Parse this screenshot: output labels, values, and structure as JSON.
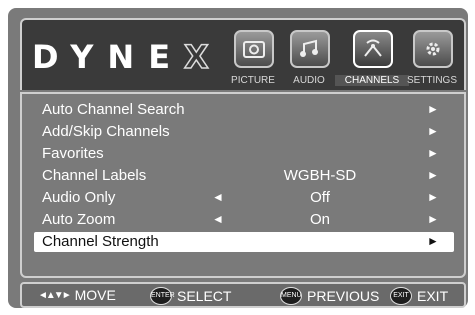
{
  "brand": {
    "logo_main": "DYNE",
    "logo_x": "X"
  },
  "tabs": [
    {
      "label": "PICTURE",
      "icon": "picture-icon",
      "active": false
    },
    {
      "label": "AUDIO",
      "icon": "audio-icon",
      "active": false
    },
    {
      "label": "CHANNELS",
      "icon": "channels-icon",
      "active": true
    },
    {
      "label": "SETTINGS",
      "icon": "settings-icon",
      "active": false
    }
  ],
  "menu": {
    "items": [
      {
        "label": "Auto Channel Search",
        "value": "",
        "has_left_arrow": false
      },
      {
        "label": "Add/Skip Channels",
        "value": "",
        "has_left_arrow": false
      },
      {
        "label": "Favorites",
        "value": "",
        "has_left_arrow": false
      },
      {
        "label": "Channel Labels",
        "value": "WGBH-SD",
        "has_left_arrow": false
      },
      {
        "label": "Audio Only",
        "value": "Off",
        "has_left_arrow": true
      },
      {
        "label": "Auto Zoom",
        "value": "On",
        "has_left_arrow": true
      },
      {
        "label": "Channel Strength",
        "value": "",
        "has_left_arrow": false,
        "selected": true
      }
    ]
  },
  "footer": {
    "move": "MOVE",
    "enter_badge": "ENTER",
    "select": "SELECT",
    "menu_badge": "MENU",
    "previous": "PREVIOUS",
    "exit_badge": "EXIT",
    "exit": "EXIT"
  },
  "colors": {
    "frame": "#7a7a7a",
    "header": "#3a3a3a",
    "selected_row": "#ffffff"
  }
}
